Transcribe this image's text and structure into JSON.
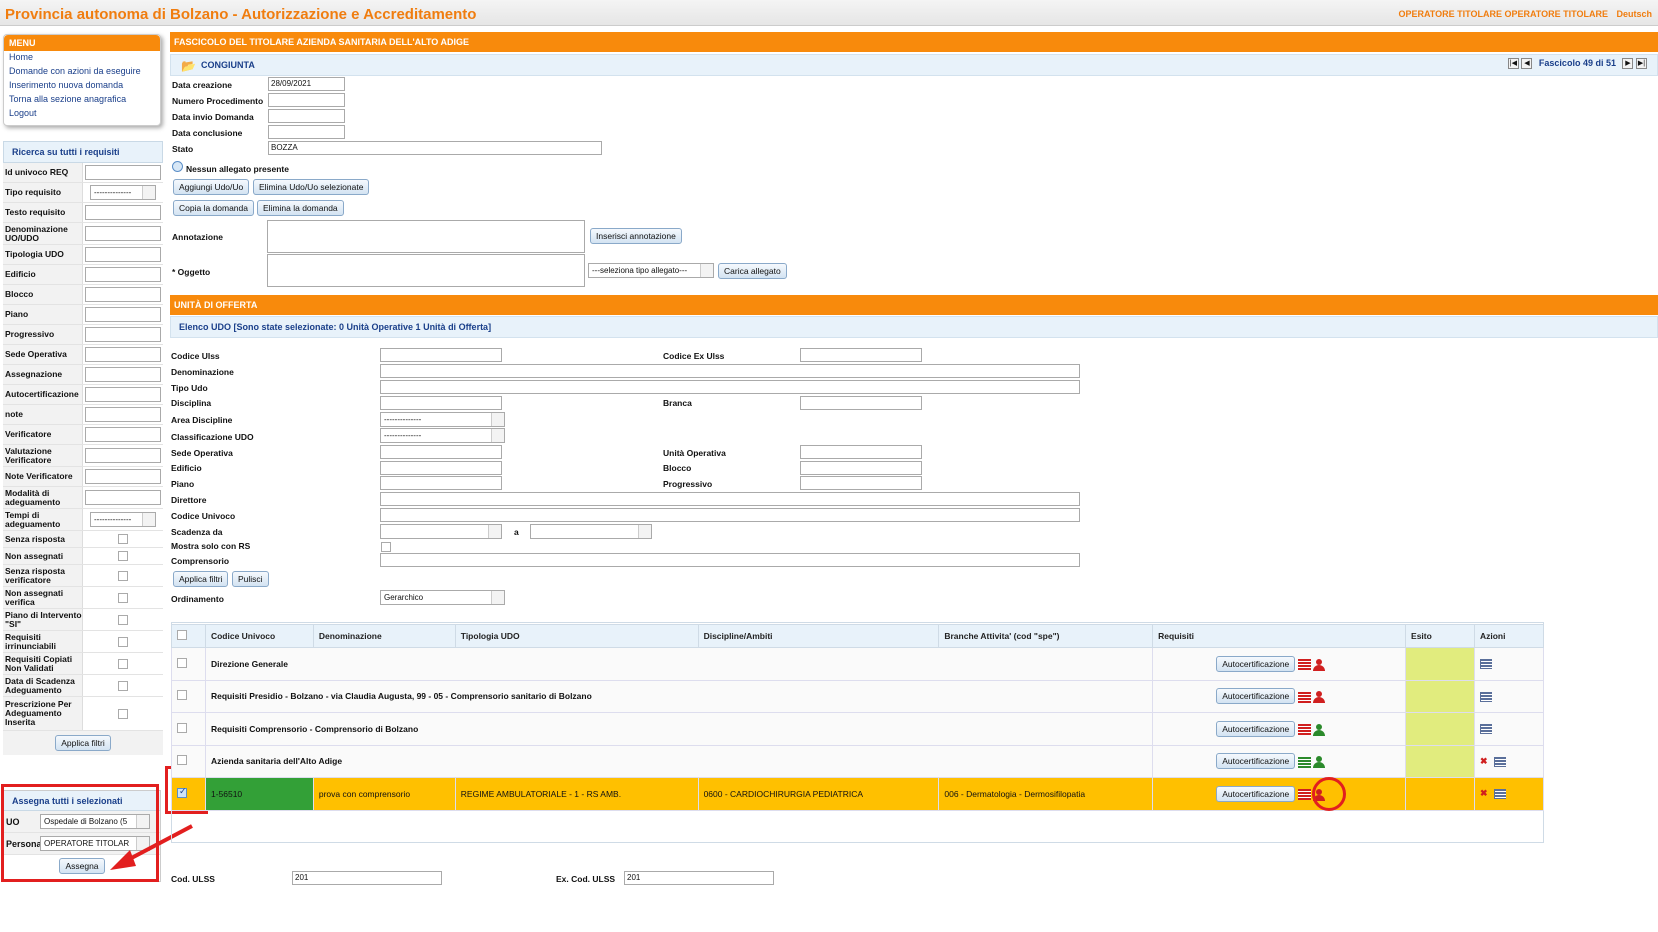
{
  "header": {
    "title": "Provincia autonoma di Bolzano - Autorizzazione e Accreditamento",
    "user": "OPERATORE TITOLARE OPERATORE TITOLARE",
    "lang": "Deutsch"
  },
  "menu": {
    "title": "MENU",
    "items": [
      "Home",
      "Domande con azioni da eseguire",
      "Inserimento nuova domanda",
      "Torna alla sezione anagrafica",
      "Logout"
    ]
  },
  "search": {
    "title": "Ricerca su tutti i requisiti",
    "fields": [
      {
        "label": "Id univoco REQ",
        "type": "text"
      },
      {
        "label": "Tipo requisito",
        "type": "select",
        "value": "--------------"
      },
      {
        "label": "Testo requisito",
        "type": "text"
      },
      {
        "label": "Denominazione UO/UDO",
        "type": "text"
      },
      {
        "label": "Tipologia UDO",
        "type": "text"
      },
      {
        "label": "Edificio",
        "type": "text"
      },
      {
        "label": "Blocco",
        "type": "text"
      },
      {
        "label": "Piano",
        "type": "text"
      },
      {
        "label": "Progressivo",
        "type": "text"
      },
      {
        "label": "Sede Operativa",
        "type": "text"
      },
      {
        "label": "Assegnazione",
        "type": "text"
      },
      {
        "label": "Autocertificazione",
        "type": "text"
      },
      {
        "label": "note",
        "type": "text"
      },
      {
        "label": "Verificatore",
        "type": "text"
      },
      {
        "label": "Valutazione Verificatore",
        "type": "text"
      },
      {
        "label": "Note Verificatore",
        "type": "text"
      },
      {
        "label": "Modalità di adeguamento",
        "type": "text"
      },
      {
        "label": "Tempi di adeguamento",
        "type": "select",
        "value": "--------------"
      },
      {
        "label": "Senza risposta",
        "type": "check"
      },
      {
        "label": "Non assegnati",
        "type": "check"
      },
      {
        "label": "Senza risposta verificatore",
        "type": "check"
      },
      {
        "label": "Non assegnati verifica",
        "type": "check"
      },
      {
        "label": "Piano di Intervento \"SI\"",
        "type": "check"
      },
      {
        "label": "Requisiti irrinunciabili",
        "type": "check"
      },
      {
        "label": "Requisiti Copiati Non Validati",
        "type": "check"
      },
      {
        "label": "Data di Scadenza Adeguamento",
        "type": "check"
      },
      {
        "label": "Prescrizione Per Adeguamento Inserita",
        "type": "check"
      }
    ],
    "apply_label": "Applica filtri"
  },
  "assign": {
    "title": "Assegna tutti i selezionati",
    "uo_label": "UO",
    "uo_value": "Ospedale di Bolzano (5",
    "persona_label": "Persona",
    "persona_value": "OPERATORE TITOLAR",
    "button": "Assegna"
  },
  "fascicolo": {
    "title": "FASCICOLO DEL TITOLARE AZIENDA SANITARIA DELL'ALTO ADIGE",
    "subtitle": "CONGIUNTA",
    "nav": "Fascicolo 49 di 51",
    "fields": [
      {
        "label": "Data creazione",
        "value": "28/09/2021"
      },
      {
        "label": "Numero Procedimento",
        "value": ""
      },
      {
        "label": "Data invio Domanda",
        "value": ""
      },
      {
        "label": "Data conclusione",
        "value": ""
      },
      {
        "label": "Stato",
        "value": "BOZZA"
      }
    ],
    "no_attach": "Nessun allegato presente",
    "buttons": [
      "Aggiungi Udo/Uo",
      "Elimina Udo/Uo selezionate",
      "Copia la domanda",
      "Elimina la domanda"
    ],
    "annotazione_label": "Annotazione",
    "annotazione_btn": "Inserisci annotazione",
    "oggetto_label": "* Oggetto",
    "tipo_allegato": "---seleziona tipo allegato---",
    "carica_btn": "Carica allegato"
  },
  "udo": {
    "title": "UNITÀ DI OFFERTA",
    "subtitle": "Elenco UDO [Sono state selezionate: 0 Unità Operative 1 Unità di Offerta]",
    "filters": {
      "codice_ulss": "Codice Ulss",
      "codice_ex_ulss": "Codice Ex Ulss",
      "denominazione": "Denominazione",
      "tipo_udo": "Tipo Udo",
      "disciplina": "Disciplina",
      "branca": "Branca",
      "area_discipline": "Area Discipline",
      "area_discipline_value": "--------------",
      "classificazione": "Classificazione UDO",
      "classificazione_value": "--------------",
      "sede_operativa": "Sede Operativa",
      "unita_operativa": "Unità Operativa",
      "edificio": "Edificio",
      "blocco": "Blocco",
      "piano": "Piano",
      "progressivo": "Progressivo",
      "direttore": "Direttore",
      "codice_univoco": "Codice Univoco",
      "scadenza_da": "Scadenza da",
      "scadenza_a": "a",
      "mostra_rs": "Mostra solo con RS",
      "comprensorio": "Comprensorio"
    },
    "apply_label": "Applica filtri",
    "clear_label": "Pulisci",
    "ordinamento_label": "Ordinamento",
    "ordinamento_value": "Gerarchico",
    "columns": [
      "Codice Univoco",
      "Denominazione",
      "Tipologia UDO",
      "Discipline/Ambiti",
      "Branche Attivita' (cod \"spe\")",
      "Requisiti",
      "Esito",
      "Azioni"
    ],
    "rows": [
      {
        "code": "Direzione Generale",
        "den": "",
        "tip": "",
        "disc": "",
        "branche": "",
        "auto": "Autocertificazione",
        "list_color": "red",
        "person_color": "red",
        "delete": false,
        "checked": false
      },
      {
        "code": "Requisiti Presidio - Bolzano - via Claudia Augusta, 99 - 05 - Comprensorio sanitario di Bolzano",
        "den": "",
        "tip": "",
        "disc": "",
        "branche": "",
        "auto": "Autocertificazione",
        "list_color": "red",
        "person_color": "red",
        "delete": false,
        "checked": false
      },
      {
        "code": "Requisiti Comprensorio - Comprensorio di Bolzano",
        "den": "",
        "tip": "",
        "disc": "",
        "branche": "",
        "auto": "Autocertificazione",
        "list_color": "red",
        "person_color": "green",
        "delete": false,
        "checked": false
      },
      {
        "code": "Azienda sanitaria dell'Alto Adige",
        "den": "",
        "tip": "",
        "disc": "",
        "branche": "",
        "auto": "Autocertificazione",
        "list_color": "green",
        "person_color": "green",
        "delete": true,
        "checked": false
      },
      {
        "code": "1-56510",
        "den": "prova con comprensorio",
        "tip": "REGIME AMBULATORIALE - 1 - RS AMB.",
        "disc": "0600 - CARDIOCHIRURGIA PEDIATRICA",
        "branche": "006 - Dermatologia - Dermosifilopatia",
        "auto": "Autocertificazione",
        "list_color": "red",
        "person_color": "red",
        "delete": true,
        "checked": true
      }
    ],
    "footer": {
      "cod_ulss_label": "Cod. ULSS",
      "cod_ulss_value": "201",
      "ex_cod_ulss_label": "Ex. Cod. ULSS",
      "ex_cod_ulss_value": "201"
    }
  },
  "colors": {
    "accent": "#f88a0c",
    "title": "#f07d0f",
    "link": "#1a3f8a",
    "highlight": "#ffc000",
    "esito": "#e1ec7e",
    "code_ok": "#33a037",
    "annotation": "#e21f1f"
  }
}
